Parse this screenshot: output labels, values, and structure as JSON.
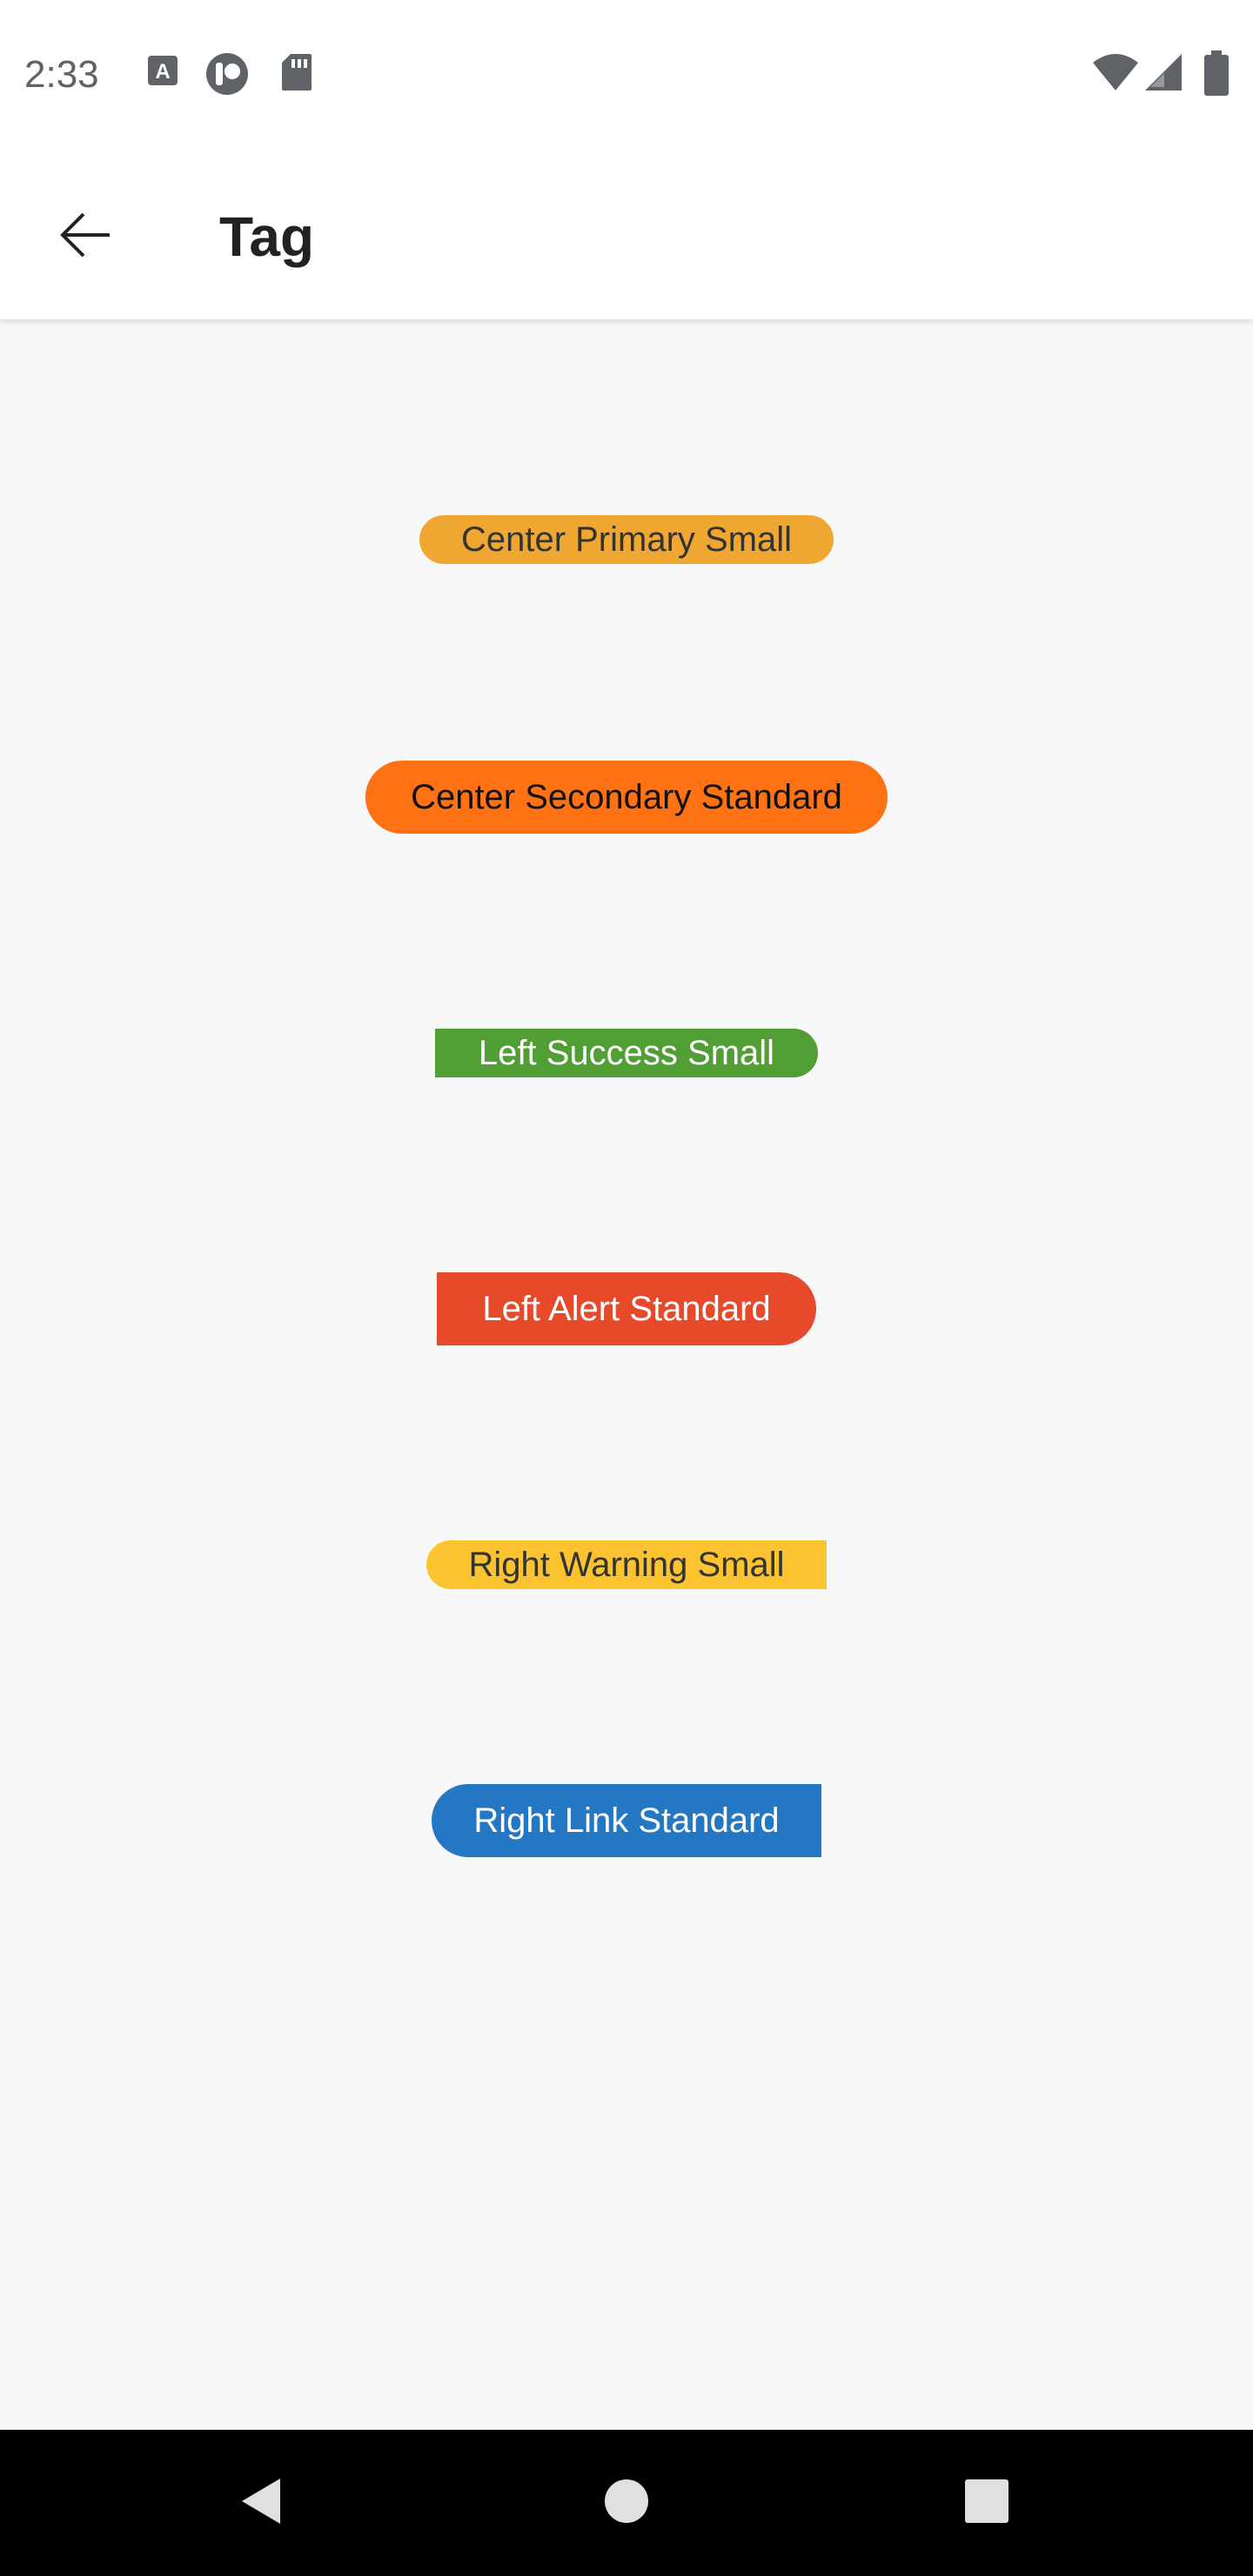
{
  "status_bar": {
    "time": "2:33",
    "icons": [
      "text-a-notification-icon",
      "toggle-notification-icon",
      "sd-card-icon",
      "wifi-icon",
      "cellular-signal-icon",
      "battery-icon"
    ]
  },
  "app_bar": {
    "title": "Tag",
    "back_icon": "arrow-back-icon"
  },
  "tags": [
    {
      "label": "Center Primary Small",
      "align": "center",
      "type": "primary",
      "size": "small",
      "color": "#F0A732",
      "text_color": "#333333"
    },
    {
      "label": "Center Secondary Standard",
      "align": "center",
      "type": "secondary",
      "size": "standard",
      "color": "#FF7214",
      "text_color": "#111111"
    },
    {
      "label": "Left Success Small",
      "align": "left",
      "type": "success",
      "size": "small",
      "color": "#519E35",
      "text_color": "#FFFFFF"
    },
    {
      "label": "Left Alert Standard",
      "align": "left",
      "type": "alert",
      "size": "standard",
      "color": "#E64A2B",
      "text_color": "#FFFFFF"
    },
    {
      "label": "Right Warning Small",
      "align": "right",
      "type": "warning",
      "size": "small",
      "color": "#FCC331",
      "text_color": "#333333"
    },
    {
      "label": "Right Link Standard",
      "align": "right",
      "type": "link",
      "size": "standard",
      "color": "#2478C3",
      "text_color": "#FFFFFF"
    }
  ],
  "nav_bar": {
    "buttons": [
      "back-triangle-icon",
      "home-circle-icon",
      "recents-square-icon"
    ]
  }
}
